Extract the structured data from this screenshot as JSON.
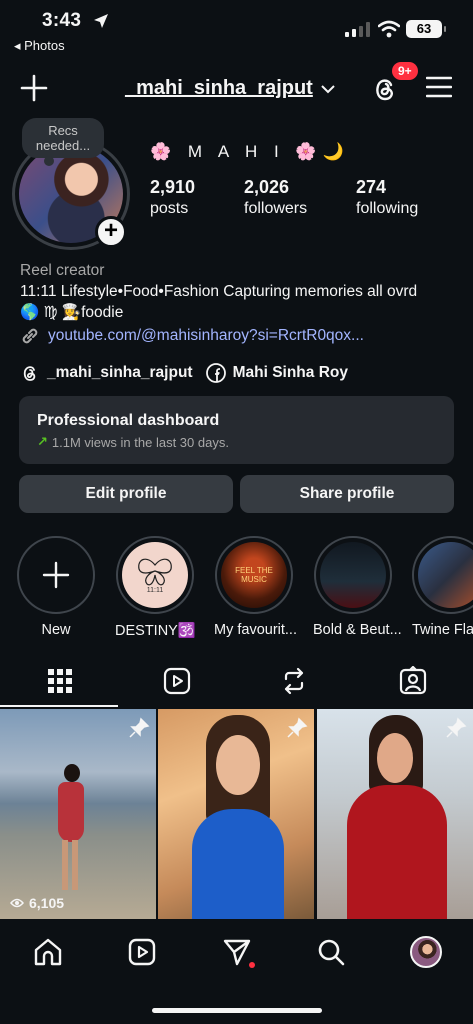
{
  "status_bar": {
    "time": "3:43",
    "back_app": "◂ Photos",
    "battery": "63"
  },
  "header": {
    "username": "_mahi_sinha_rajput",
    "notif_badge": "9+"
  },
  "profile": {
    "recs_note": "Recs needed...",
    "display_name": "🌸 M A H I 🌸🌙",
    "stats": [
      {
        "value": "2,910",
        "label": "posts"
      },
      {
        "value": "2,026",
        "label": "followers"
      },
      {
        "value": "274",
        "label": "following"
      }
    ],
    "category": "Reel creator",
    "bio_line1": "11:11 Lifestyle•Food•Fashion Capturing memories all ovrd",
    "bio_line2": "🌎 ♍ 👩‍🍳foodie",
    "link": "youtube.com/@mahisinharoy?si=RcrtR0qox...",
    "threads_handle": "_mahi_sinha_rajput",
    "facebook_name": "Mahi Sinha Roy"
  },
  "dashboard": {
    "title": "Professional dashboard",
    "subtitle": "1.1M views in the last 30 days."
  },
  "buttons": {
    "edit": "Edit profile",
    "share": "Share profile"
  },
  "highlights": [
    {
      "label": "New"
    },
    {
      "label": "DESTINY🕉️"
    },
    {
      "label": "My favourit..."
    },
    {
      "label": "Bold & Beut..."
    },
    {
      "label": "Twine Fla"
    }
  ],
  "highlight_art": {
    "music_text": "FEEL THE MUSIC",
    "destiny_text": "11:11"
  },
  "posts": [
    {
      "views": "6,105"
    }
  ],
  "colors": {
    "background": "#0c1014",
    "accent_link": "#a3b5ff",
    "badge": "#ff3040",
    "trend": "#58c322"
  }
}
